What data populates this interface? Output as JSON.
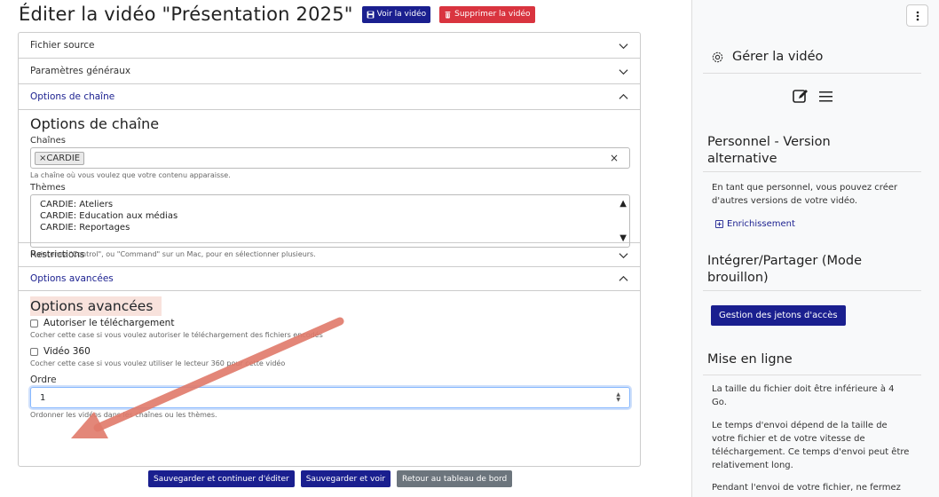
{
  "header": {
    "title": "Éditer la vidéo \"Présentation 2025\"",
    "view_button": "Voir la vidéo",
    "delete_button": "Supprimer la vidéo"
  },
  "accordion": {
    "source_file": "Fichier source",
    "general_params": "Paramètres généraux",
    "channel_options": "Options de chaîne",
    "restrictions": "Restrictions",
    "advanced_options": "Options avancées"
  },
  "channel_section": {
    "title": "Options de chaîne",
    "channels_label": "Chaînes",
    "channel_tag": "×CARDIE",
    "clear": "×",
    "channels_help": "La chaîne où vous voulez que votre contenu apparaisse.",
    "themes_label": "Thèmes",
    "themes": [
      "CARDIE: Ateliers",
      "CARDIE: Education aux médias",
      "CARDIE: Reportages"
    ],
    "themes_help": "Maintenez \"Control\", ou \"Command\" sur un Mac, pour en sélectionner plusieurs."
  },
  "advanced_section": {
    "title": "Options avancées",
    "download_label": "Autoriser le téléchargement",
    "download_help": "Cocher cette case si vous voulez autoriser le téléchargement des fichiers encodés",
    "video360_label": "Vidéo 360",
    "video360_help": "Cocher cette case si vous voulez utiliser le lecteur 360 pour cette vidéo",
    "order_label": "Ordre",
    "order_value": "1",
    "order_help": "Ordonner les vidéos dans les chaînes ou les thèmes."
  },
  "footer": {
    "save_continue": "Sauvegarder et continuer d'éditer",
    "save_view": "Sauvegarder et voir",
    "back_dashboard": "Retour au tableau de bord"
  },
  "sidebar": {
    "manage_title": "Gérer la vidéo",
    "personal_title": "Personnel - Version alternative",
    "personal_text": "En tant que personnel, vous pouvez créer d'autres versions de votre vidéo.",
    "enrich_link": "Enrichissement",
    "embed_title": "Intégrer/Partager (Mode brouillon)",
    "tokens_button": "Gestion des jetons d'accès",
    "upload_title": "Mise en ligne",
    "upload_text1": "La taille du fichier doit être inférieure à 4 Go.",
    "upload_text2": "Le temps d'envoi dépend de la taille de votre fichier et de votre vitesse de téléchargement. Ce temps d'envoi peut être relativement long.",
    "upload_text3": "Pendant l'envoi de votre fichier, ne fermez"
  },
  "colors": {
    "navy": "#1a1f8f",
    "red": "#d9343f",
    "gray": "#6c757d",
    "annotation_arrow": "#e07a6a"
  }
}
